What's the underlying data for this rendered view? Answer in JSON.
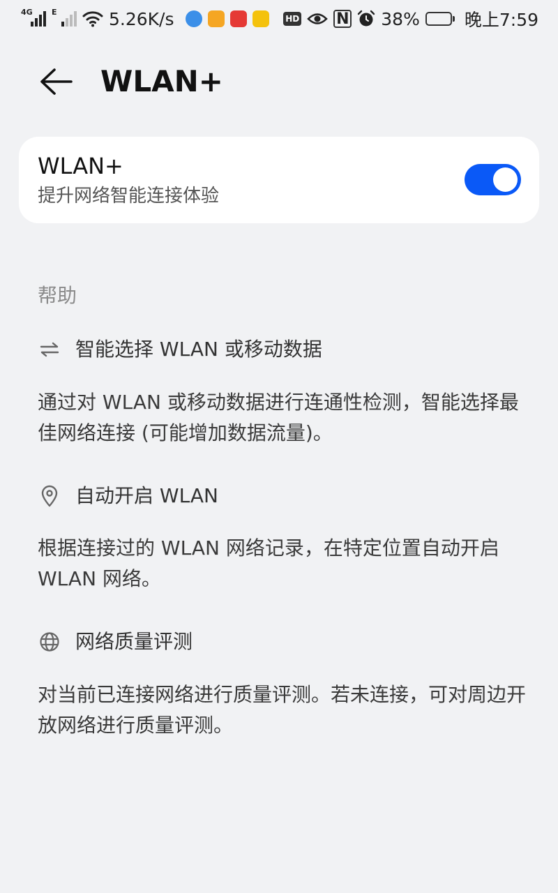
{
  "status_bar": {
    "sim1_tag": "4G",
    "sim2_tag": "E",
    "net_speed": "5.26K/s",
    "hd_label": "HD",
    "nfc_label": "N",
    "battery_percent": "38%",
    "battery_level": 0.38,
    "time": "晚上7:59",
    "app_colors": [
      "#3b8fe8",
      "#f5a623",
      "#e53935",
      "#f4c20d"
    ]
  },
  "header": {
    "back_icon": "arrow-left-icon",
    "title": "WLAN+"
  },
  "wlan_plus": {
    "title": "WLAN+",
    "subtitle": "提升网络智能连接体验",
    "enabled": true,
    "accent_color": "#0a59f7"
  },
  "help": {
    "title": "帮助",
    "items": [
      {
        "icon": "swap-arrows-icon",
        "label": "智能选择 WLAN 或移动数据",
        "description": "通过对 WLAN 或移动数据进行连通性检测，智能选择最佳网络连接 (可能增加数据流量)。"
      },
      {
        "icon": "location-pin-icon",
        "label": "自动开启 WLAN",
        "description": "根据连接过的 WLAN 网络记录，在特定位置自动开启 WLAN 网络。"
      },
      {
        "icon": "globe-icon",
        "label": "网络质量评测",
        "description": "对当前已连接网络进行质量评测。若未连接，可对周边开放网络进行质量评测。"
      }
    ]
  }
}
